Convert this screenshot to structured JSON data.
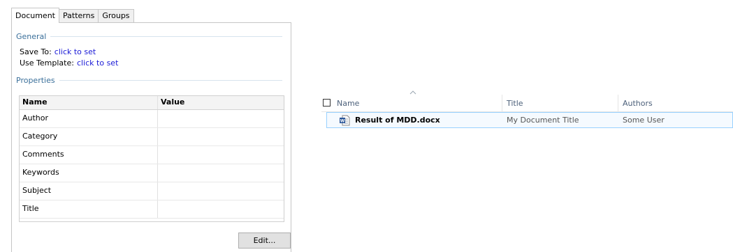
{
  "tabs": [
    {
      "label": "Document",
      "active": true
    },
    {
      "label": "Patterns",
      "active": false
    },
    {
      "label": "Groups",
      "active": false
    }
  ],
  "general": {
    "header": "General",
    "save_to_label": "Save To:",
    "save_to_value": "click to set",
    "template_label": "Use Template:",
    "template_value": "click to set"
  },
  "properties": {
    "header": "Properties",
    "columns": [
      "Name",
      "Value"
    ],
    "rows": [
      {
        "name": "Author",
        "value": ""
      },
      {
        "name": "Category",
        "value": ""
      },
      {
        "name": "Comments",
        "value": ""
      },
      {
        "name": "Keywords",
        "value": ""
      },
      {
        "name": "Subject",
        "value": ""
      },
      {
        "name": "Title",
        "value": ""
      }
    ]
  },
  "edit_button": "Edit...",
  "explorer": {
    "columns": [
      "Name",
      "Title",
      "Authors"
    ],
    "files": [
      {
        "name": "Result of MDD.docx",
        "title": "My Document Title",
        "authors": "Some User"
      }
    ]
  },
  "colors": {
    "group_header": "#3a6f9a",
    "link": "#1a1ad6",
    "selection_border": "#99d1ff",
    "word_blue": "#2b579a"
  },
  "icons": {
    "file": "word-document-icon",
    "sort": "sort-ascending-icon"
  }
}
